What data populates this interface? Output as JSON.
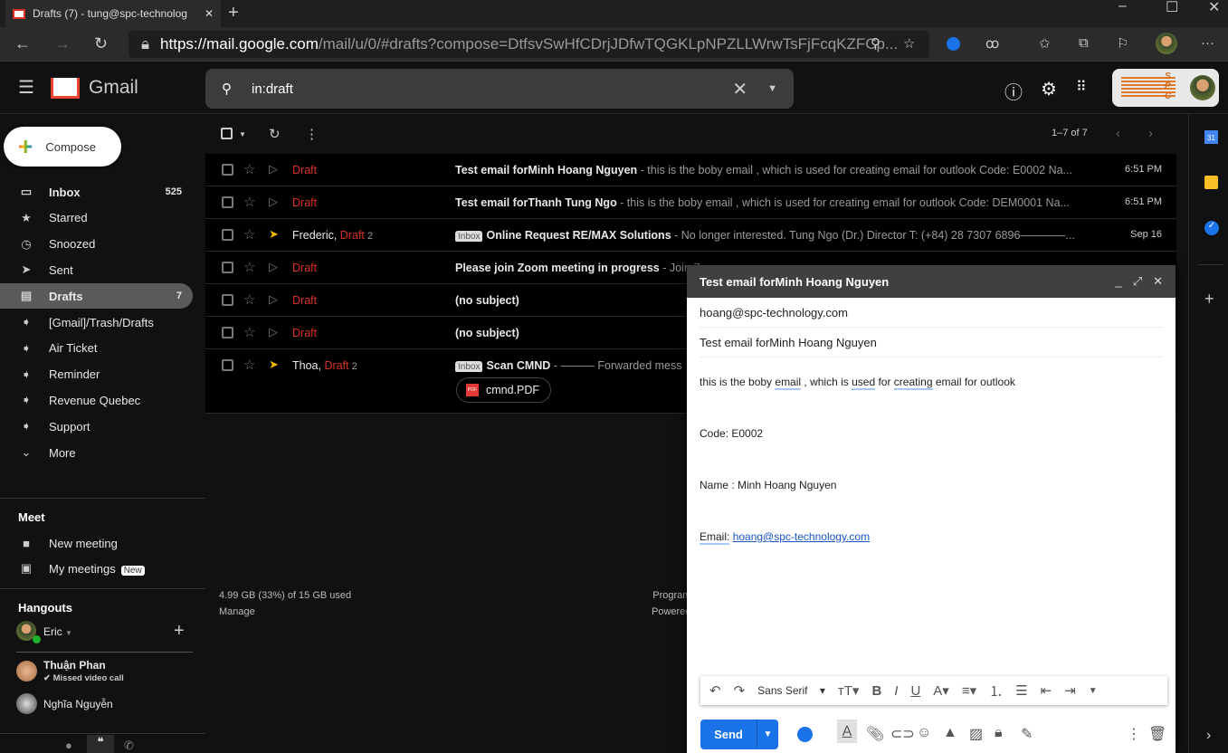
{
  "browser": {
    "tab_title": "Drafts (7) - tung@spc-technolog",
    "url_host": "https://mail.google.com",
    "url_path": "/mail/u/0/#drafts?compose=DtfsvSwHfCDrjJDfwTQGKLpNPZLLWrwTsFjFcqKZFCp..."
  },
  "header": {
    "app_name": "Gmail",
    "search_value": "in:draft",
    "account_logo_text": "SPC"
  },
  "compose_button": "Compose",
  "sidebar": {
    "items": [
      {
        "label": "Inbox",
        "count": "525",
        "icon": "inbox-icon",
        "bold": true
      },
      {
        "label": "Starred",
        "icon": "star-icon"
      },
      {
        "label": "Snoozed",
        "icon": "clock-icon"
      },
      {
        "label": "Sent",
        "icon": "send-icon"
      },
      {
        "label": "Drafts",
        "count": "7",
        "icon": "draft-icon",
        "active": true
      },
      {
        "label": "[Gmail]/Trash/Drafts",
        "icon": "label-icon"
      },
      {
        "label": "Air Ticket",
        "icon": "label-icon"
      },
      {
        "label": "Reminder",
        "icon": "label-icon"
      },
      {
        "label": "Revenue Quebec",
        "icon": "label-icon"
      },
      {
        "label": "Support",
        "icon": "label-icon"
      },
      {
        "label": "More",
        "icon": "chevron-down-icon"
      }
    ],
    "meet": {
      "title": "Meet",
      "new_meeting": "New meeting",
      "my_meetings": "My meetings",
      "new_badge": "New"
    },
    "hangouts": {
      "title": "Hangouts",
      "user": "Eric",
      "contacts": [
        {
          "name": "Thuận Phan",
          "status": "Missed video call"
        },
        {
          "name": "Nghĩa Nguyễn"
        }
      ]
    }
  },
  "toolbar": {
    "pagination": "1–7 of 7"
  },
  "emails": [
    {
      "sender": "",
      "draft": "Draft",
      "subject": "Test email forMinh Hoang Nguyen",
      "snippet": " - this is the boby email , which is used for creating email for outlook Code: E0002 Na...",
      "time": "6:51 PM"
    },
    {
      "sender": "",
      "draft": "Draft",
      "subject": "Test email forThanh Tung Ngo",
      "snippet": " - this is the boby email , which is used for creating email for outlook Code: DEM0001 Na...",
      "time": "6:51 PM"
    },
    {
      "sender": "Frederic, ",
      "draft": "Draft",
      "count": " 2",
      "label": "Inbox",
      "subject": "Online Request RE/MAX Solutions",
      "snippet": " - No longer interested. Tung Ngo (Dr.) Director T: (+84) 28 7307 6896————...",
      "time": "Sep 16",
      "important": true
    },
    {
      "sender": "",
      "draft": "Draft",
      "subject": "Please join Zoom meeting in progress",
      "snippet": " - Join Z",
      "time": ""
    },
    {
      "sender": "",
      "draft": "Draft",
      "subject": "(no subject)",
      "snippet": "",
      "time": ""
    },
    {
      "sender": "",
      "draft": "Draft",
      "subject": "(no subject)",
      "snippet": "",
      "time": ""
    },
    {
      "sender": "Thoa, ",
      "draft": "Draft",
      "count": " 2",
      "label": "Inbox",
      "subject": "Scan CMND",
      "snippet": " - ——— Forwarded mess",
      "time": "",
      "important": true,
      "attachment": "cmnd.PDF"
    }
  ],
  "footer": {
    "storage": "4.99 GB (33%) of 15 GB used",
    "manage": "Manage",
    "program": "Program",
    "powered": "Powered"
  },
  "compose": {
    "title": "Test email forMinh Hoang Nguyen",
    "to": "hoang@spc-technology.com",
    "subject": "Test email forMinh Hoang Nguyen",
    "body": {
      "line1_a": "this is the boby ",
      "line1_b": "email",
      "line1_c": " , which is ",
      "line1_d": "used",
      "line1_e": " for ",
      "line1_f": "creating",
      "line1_g": " email for outlook",
      "code": "Code: E0002",
      "name": "Name :  Minh Hoang  Nguyen",
      "email_label": "Email:",
      "email_link": "hoang@spc-technology.com"
    },
    "font": "Sans Serif",
    "send": "Send"
  },
  "colors": {
    "draft": "#d93025",
    "send": "#1a73e8",
    "important": "#f2b600"
  }
}
